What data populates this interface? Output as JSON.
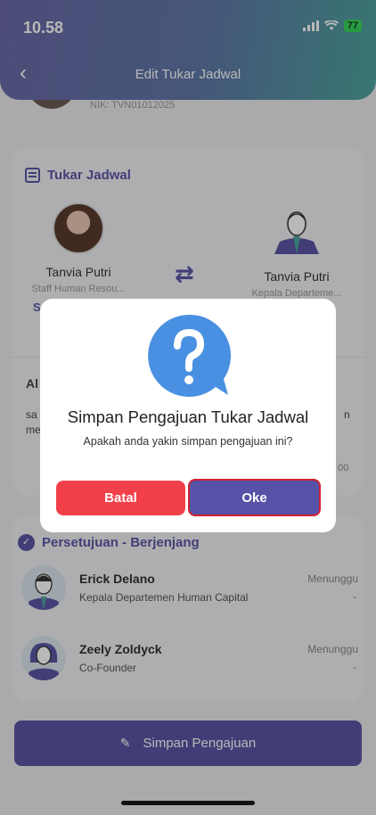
{
  "status_bar": {
    "time": "10.58",
    "battery": "77"
  },
  "header": {
    "title": "Edit Tukar Jadwal"
  },
  "profile": {
    "nik": "NIK: TVN01012025"
  },
  "swap_section": {
    "title": "Tukar Jadwal",
    "left_person": {
      "name": "Tanvia Putri",
      "role": "Staff Human Resou..."
    },
    "right_person": {
      "name": "Tanvia Putri",
      "role": "Kepala Departeme..."
    }
  },
  "background_fragments": {
    "f1": "S",
    "f2": "Al",
    "f3": "sa",
    "f4": "me",
    "f5": "n",
    "f6": "00"
  },
  "approval_section": {
    "title": "Persetujuan - Berjenjang",
    "approvers": [
      {
        "name": "Erick Delano",
        "role": "Kepala Departemen Human Capital",
        "status": "Menunggu",
        "date": "-"
      },
      {
        "name": "Zeely Zoldyck",
        "role": "Co-Founder",
        "status": "Menunggu",
        "date": "-"
      }
    ]
  },
  "submit_button": {
    "label": "Simpan Pengajuan"
  },
  "modal": {
    "title": "Simpan Pengajuan Tukar Jadwal",
    "message": "Apakah anda yakin simpan pengajuan ini?",
    "cancel_label": "Batal",
    "confirm_label": "Oke"
  },
  "colors": {
    "primary": "#5a57a6",
    "danger": "#f1404a",
    "modal_icon": "#4a90e2"
  }
}
